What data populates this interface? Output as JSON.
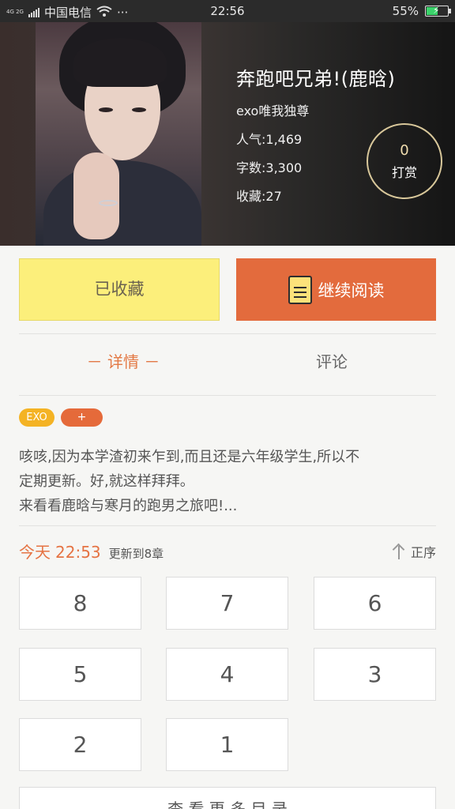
{
  "status_bar": {
    "network": "4G 2G",
    "carrier": "中国电信",
    "more": "···",
    "time": "22:56",
    "battery": "55%",
    "battery_level": 0.55
  },
  "book": {
    "title": "奔跑吧兄弟!(鹿晗)",
    "author": "exo唯我独尊",
    "popularity": "人气:1,469",
    "word_count": "字数:3,300",
    "favorites": "收藏:27"
  },
  "reward": {
    "count": "0",
    "label": "打赏"
  },
  "actions": {
    "favorite_label": "已收藏",
    "read_label": "继续阅读"
  },
  "tabs": {
    "detail": "－ 详情 －",
    "comments": "评论"
  },
  "tags": {
    "exo": "EXO",
    "add": "+"
  },
  "description": [
    "咳咳,因为本学渣初来乍到,而且还是六年级学生,所以不",
    "定期更新。好,就这样拜拜。",
    "来看看鹿晗与寒月的跑男之旅吧!..."
  ],
  "update": {
    "day": "今天",
    "time": "22:53",
    "text": "更新到8章"
  },
  "sort": {
    "label": "正序"
  },
  "chapters": [
    "8",
    "7",
    "6",
    "5",
    "4",
    "3",
    "2",
    "1"
  ],
  "bottom_text": "—— 查 看 更 多 目 录 ——"
}
